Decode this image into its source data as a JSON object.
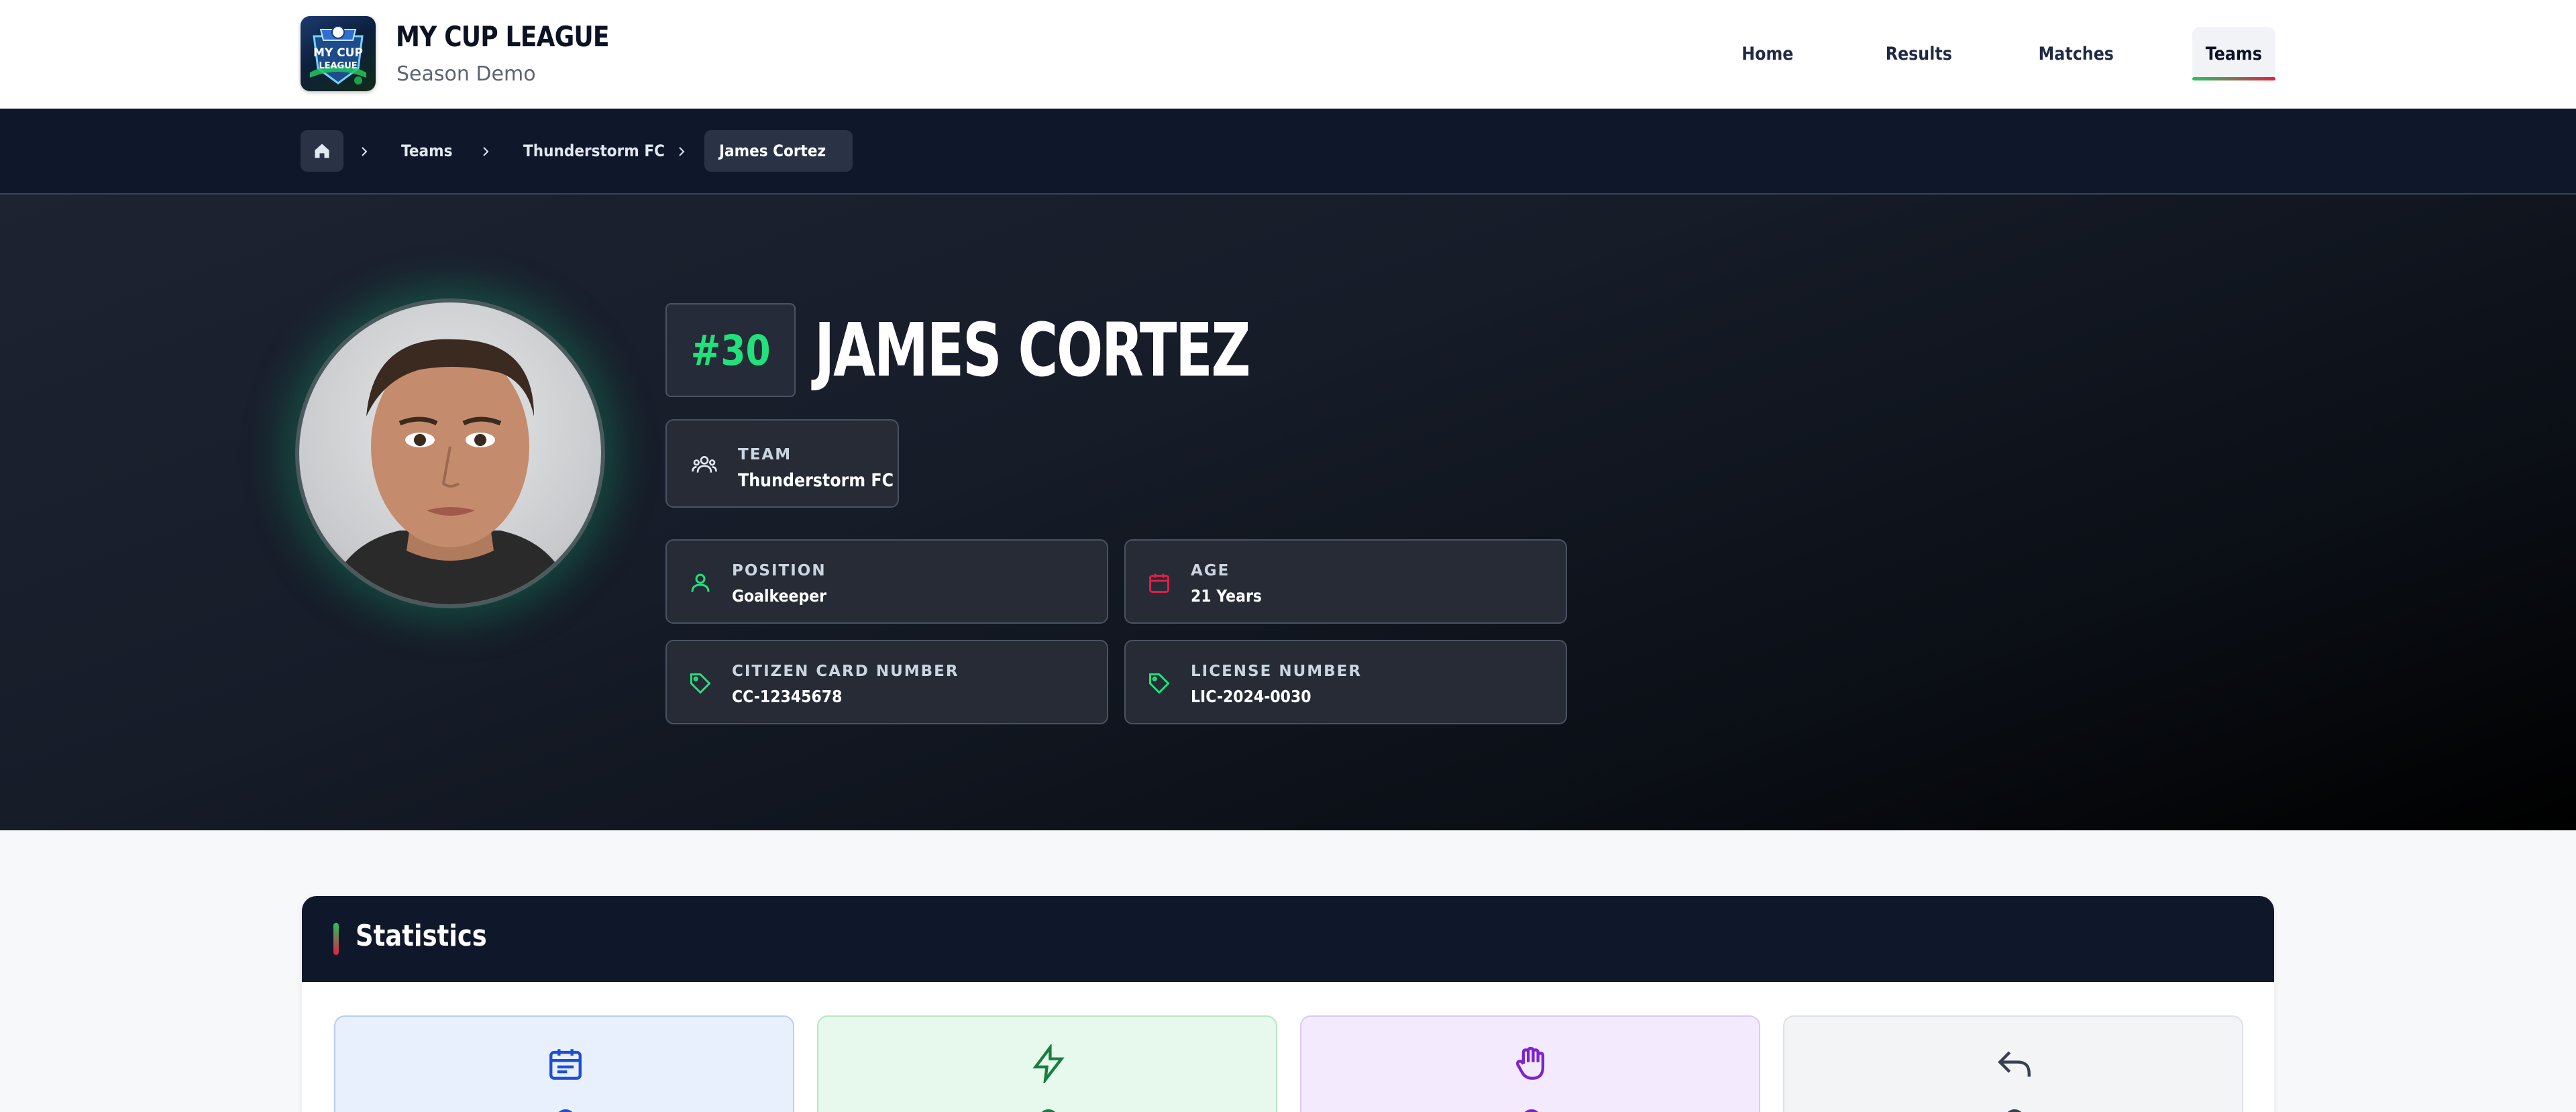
{
  "header": {
    "brand_title": "MY CUP LEAGUE",
    "brand_subtitle": "Season Demo",
    "logo_text_top": "MY CUP",
    "logo_text_bottom": "LEAGUE",
    "nav": [
      {
        "label": "Home",
        "active": false
      },
      {
        "label": "Results",
        "active": false
      },
      {
        "label": "Matches",
        "active": false
      },
      {
        "label": "Teams",
        "active": true
      }
    ]
  },
  "breadcrumb": {
    "home_icon": "home-icon",
    "items": [
      "Teams",
      "Thunderstorm FC",
      "James Cortez"
    ]
  },
  "player": {
    "number": "#30",
    "name": "JAMES CORTEZ",
    "team_label": "TEAM",
    "team_value": "Thunderstorm FC",
    "position_label": "POSITION",
    "position_value": "Goalkeeper",
    "age_label": "AGE",
    "age_value": "21 Years",
    "citizen_label": "CITIZEN CARD NUMBER",
    "citizen_value": "CC-12345678",
    "license_label": "LICENSE NUMBER",
    "license_value": "LIC-2024-0030"
  },
  "statistics": {
    "title": "Statistics",
    "cards": [
      {
        "icon": "calendar-icon",
        "color": "#1d4ed8"
      },
      {
        "icon": "lightning-icon",
        "color": "#15803d"
      },
      {
        "icon": "hand-icon",
        "color": "#7e22ce"
      },
      {
        "icon": "reply-arrow-icon",
        "color": "#374151"
      }
    ]
  },
  "colors": {
    "accent_green": "#22e07a",
    "accent_red": "#e11d48",
    "dark_navy": "#0f172a"
  }
}
